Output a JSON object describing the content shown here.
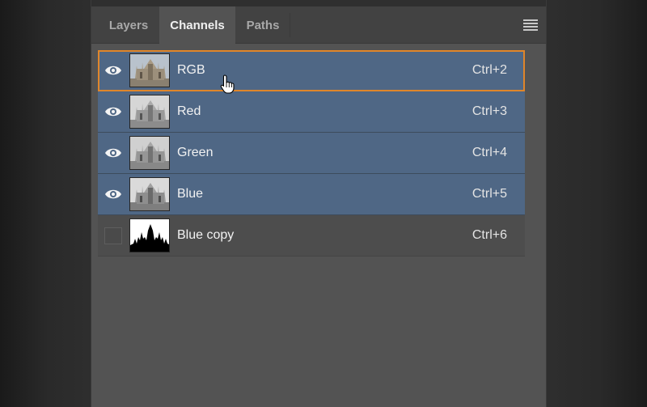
{
  "panel": {
    "tabs": [
      {
        "label": "Layers",
        "active": false
      },
      {
        "label": "Channels",
        "active": true
      },
      {
        "label": "Paths",
        "active": false
      }
    ],
    "menu_icon": "hamburger-menu-icon"
  },
  "channels": [
    {
      "name": "RGB",
      "shortcut": "Ctrl+2",
      "visible": true,
      "selected": true,
      "focused": true,
      "thumbnail": "color-building"
    },
    {
      "name": "Red",
      "shortcut": "Ctrl+3",
      "visible": true,
      "selected": true,
      "focused": false,
      "thumbnail": "gray-building"
    },
    {
      "name": "Green",
      "shortcut": "Ctrl+4",
      "visible": true,
      "selected": true,
      "focused": false,
      "thumbnail": "gray-building"
    },
    {
      "name": "Blue",
      "shortcut": "Ctrl+5",
      "visible": true,
      "selected": true,
      "focused": false,
      "thumbnail": "gray-building"
    },
    {
      "name": "Blue copy",
      "shortcut": "Ctrl+6",
      "visible": false,
      "selected": false,
      "focused": false,
      "thumbnail": "black-silhouette"
    }
  ],
  "colors": {
    "selected_row": "#4f6785",
    "focus_outline": "#e0862a",
    "panel_bg": "#535353"
  }
}
